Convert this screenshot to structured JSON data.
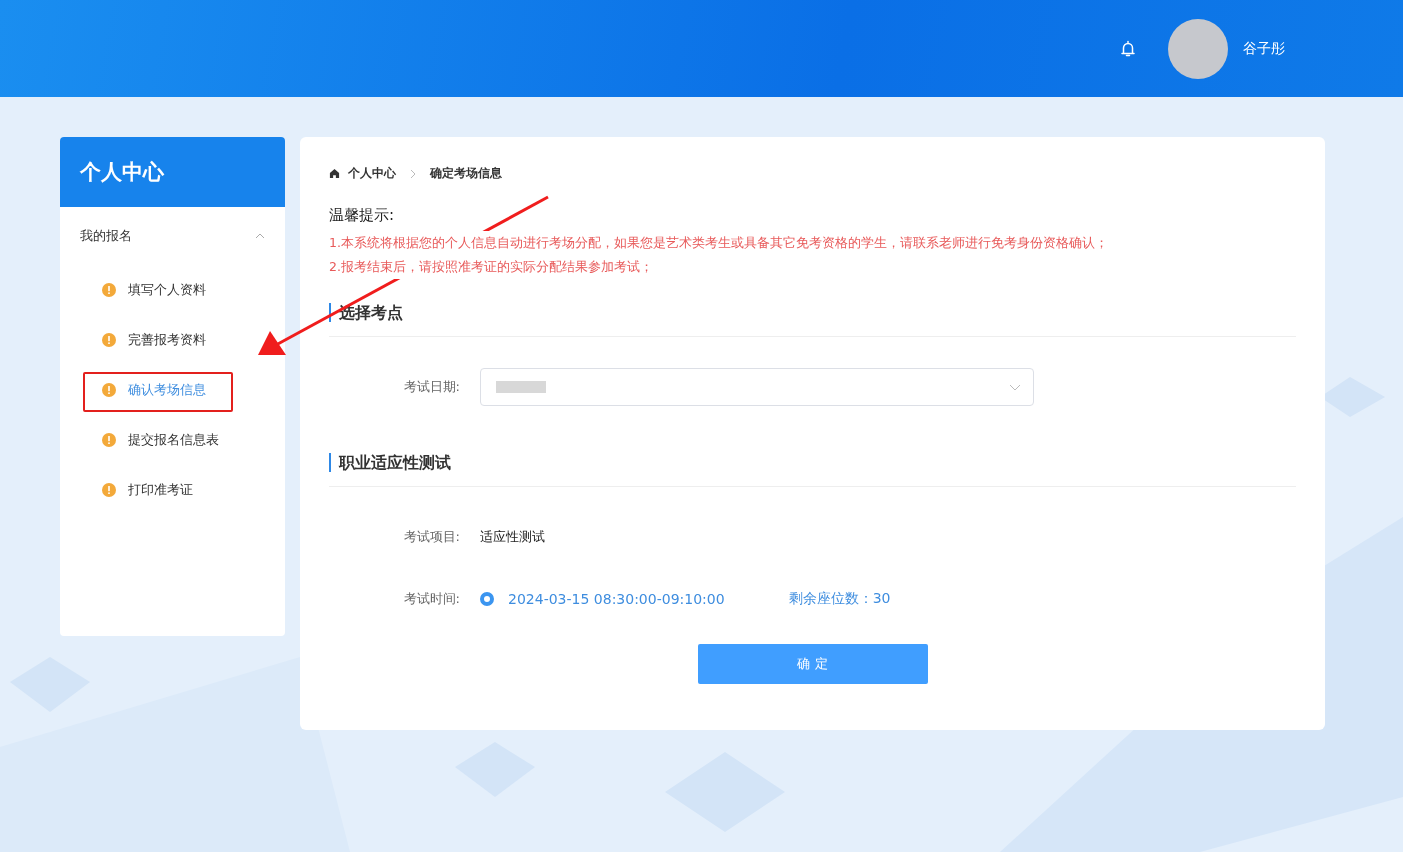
{
  "header": {
    "user_name": "谷子彤"
  },
  "sidebar": {
    "title": "个人中心",
    "group": {
      "label": "我的报名",
      "expanded": true,
      "items": [
        {
          "label": "填写个人资料",
          "selected": false
        },
        {
          "label": "完善报考资料",
          "selected": false
        },
        {
          "label": "确认考场信息",
          "selected": true
        },
        {
          "label": "提交报名信息表",
          "selected": false
        },
        {
          "label": "打印准考证",
          "selected": false
        }
      ]
    }
  },
  "breadcrumb": [
    "个人中心",
    "确定考场信息"
  ],
  "notice": {
    "title": "温馨提示:",
    "lines": [
      "1.本系统将根据您的个人信息自动进行考场分配，如果您是艺术类考生或具备其它免考资格的学生，请联系老师进行免考身份资格确认；",
      "2.报考结束后，请按照准考证的实际分配结果参加考试；"
    ]
  },
  "sections": [
    {
      "title": "选择考点",
      "fields": [
        {
          "kind": "select",
          "label": "考试日期:"
        }
      ]
    },
    {
      "title": "职业适应性测试",
      "fields": [
        {
          "kind": "text",
          "label": "考试项目:",
          "value": "适应性测试"
        },
        {
          "kind": "radio",
          "label": "考试时间:",
          "value": "2024-03-15 08:30:00-09:10:00",
          "selected": true,
          "seats": "剩余座位数：30"
        }
      ]
    }
  ],
  "confirm_button": "确 定"
}
